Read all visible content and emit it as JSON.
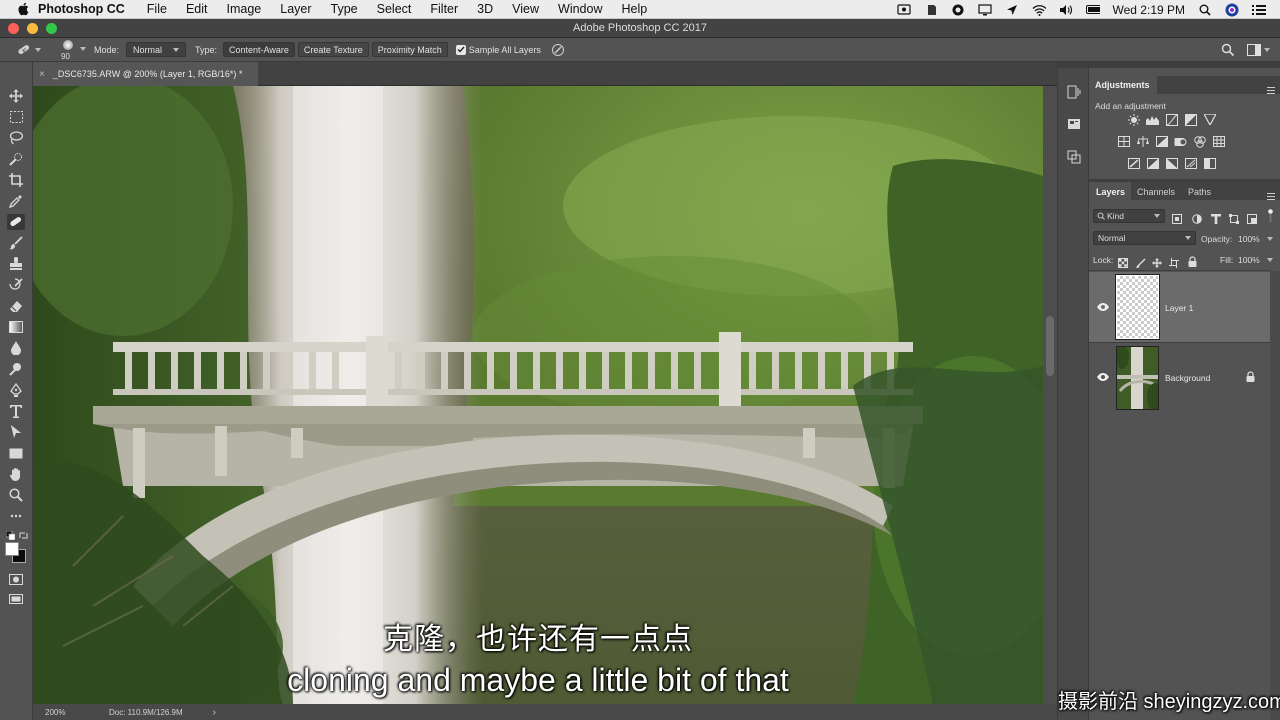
{
  "menubar": {
    "app_name": "Photoshop CC",
    "items": [
      "File",
      "Edit",
      "Image",
      "Layer",
      "Type",
      "Select",
      "Filter",
      "3D",
      "View",
      "Window",
      "Help"
    ],
    "clock": "Wed 2:19 PM"
  },
  "window": {
    "title": "Adobe Photoshop CC 2017"
  },
  "options_bar": {
    "brush_size": "90",
    "mode_label": "Mode:",
    "mode_value": "Normal",
    "type_label": "Type:",
    "type_options": [
      "Content-Aware",
      "Create Texture",
      "Proximity Match"
    ],
    "sample_all_label": "Sample All Layers",
    "sample_all_checked": true
  },
  "document": {
    "tab_title": "_DSC6735.ARW @ 200% (Layer 1, RGB/16*) *",
    "close_glyph": "×"
  },
  "status_bar": {
    "zoom": "200%",
    "doc_size": "Doc: 110.9M/126.9M",
    "arrow": "›"
  },
  "adjustments": {
    "tab": "Adjustments",
    "subtitle": "Add an adjustment"
  },
  "layers_panel": {
    "tabs": [
      "Layers",
      "Channels",
      "Paths"
    ],
    "filter_kind": "Kind",
    "blend_mode": "Normal",
    "opacity_label": "Opacity:",
    "opacity_value": "100%",
    "lock_label": "Lock:",
    "fill_label": "Fill:",
    "fill_value": "100%",
    "layers": [
      {
        "name": "Layer 1",
        "selected": true,
        "locked": false
      },
      {
        "name": "Background",
        "selected": false,
        "locked": true
      }
    ]
  },
  "subtitles": {
    "chinese": "克隆，也许还有一点点",
    "english": "cloning and maybe a little bit of that"
  },
  "watermark": "摄影前沿 sheyingzyz.com",
  "colors": {
    "menubar_bg": "#ececec",
    "chrome_dark": "#535353",
    "panel_bg": "#535353",
    "traffic_close": "#fc605b",
    "traffic_min": "#fdbc40",
    "traffic_max": "#34c84a"
  }
}
